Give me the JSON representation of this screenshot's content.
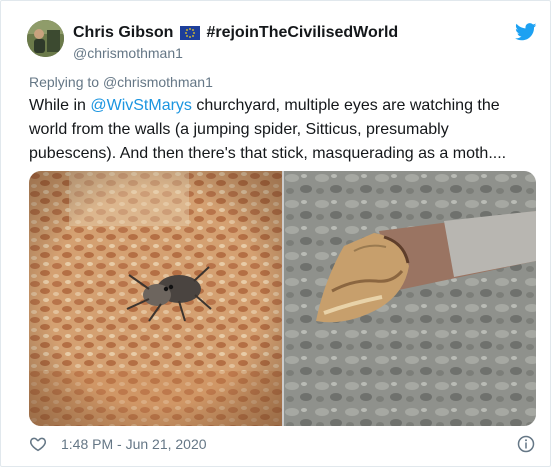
{
  "author": {
    "name": "Chris Gibson",
    "hashtag": "#rejoinTheCivilisedWorld",
    "handle": "@chrismothman1"
  },
  "reply": {
    "prefix": "Replying to",
    "to": "@chrismothman1"
  },
  "tweet": {
    "text_before": "While in ",
    "mention": "@WivStMarys",
    "text_after": " churchyard, multiple eyes are watching the world from the walls (a jumping spider, Sitticus, presumably pubescens). And then there's that stick, masquerading as a moth...."
  },
  "footer": {
    "timestamp": "1:48 PM - Jun 21, 2020"
  },
  "icons": {
    "flag": "eu-flag-icon",
    "logo": "twitter-bird-icon",
    "like": "heart-icon",
    "info": "info-icon"
  },
  "colors": {
    "link": "#1b95e0",
    "muted": "#657786",
    "brand": "#1da1f2",
    "text": "#14171a"
  }
}
